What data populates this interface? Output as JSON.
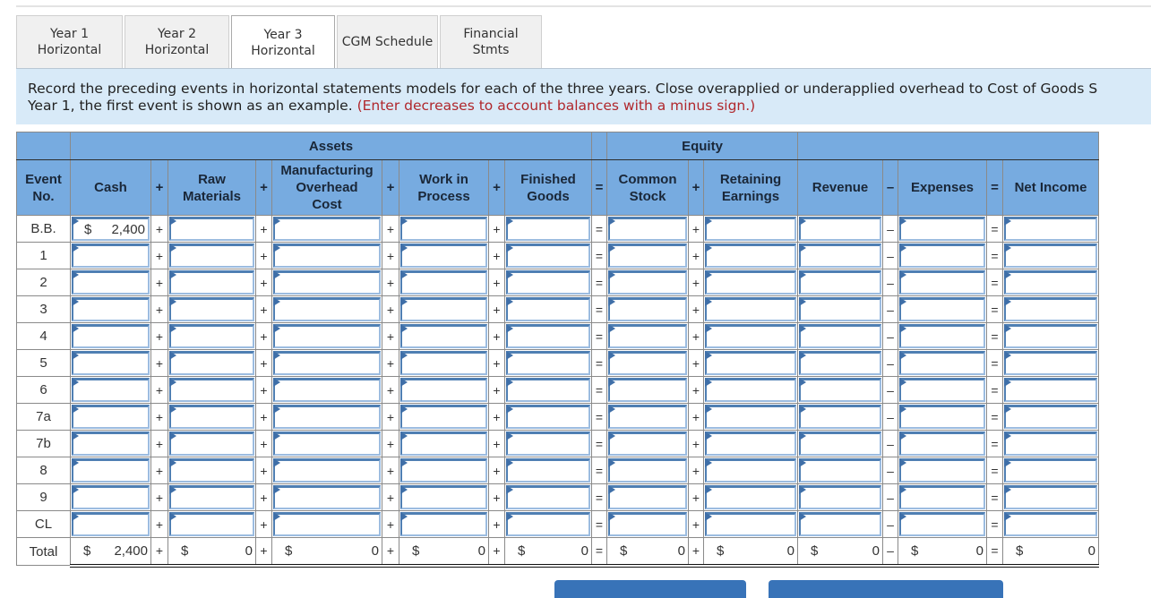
{
  "tabs": [
    {
      "label": "Year 1\nHorizontal",
      "line1": "Year 1",
      "line2": "Horizontal",
      "active": false
    },
    {
      "label": "Year 2\nHorizontal",
      "line1": "Year 2",
      "line2": "Horizontal",
      "active": false
    },
    {
      "label": "Year 3\nHorizontal",
      "line1": "Year 3",
      "line2": "Horizontal",
      "active": true
    },
    {
      "label": "CGM Schedule",
      "line1": "CGM Schedule",
      "line2": "",
      "active": false
    },
    {
      "label": "Financial\nStmts",
      "line1": "Financial",
      "line2": "Stmts",
      "active": false
    }
  ],
  "instructions": {
    "line1": "Record the preceding events in horizontal statements models for each of the three years. Close overapplied or underapplied overhead to Cost of Goods S",
    "line2": "Year 1, the first event is shown as an example. ",
    "hint": "(Enter decreases to account balances with a minus sign.)"
  },
  "table": {
    "group_headers": {
      "assets": "Assets",
      "equity": "Equity"
    },
    "column_headers": {
      "event": [
        "Event",
        "No."
      ],
      "cash": [
        "Cash"
      ],
      "raw_materials": [
        "Raw",
        "Materials"
      ],
      "moh": [
        "Manufacturing",
        "Overhead",
        "Cost"
      ],
      "wip": [
        "Work in",
        "Process"
      ],
      "fg": [
        "Finished",
        "Goods"
      ],
      "cs": [
        "Common",
        "Stock"
      ],
      "re": [
        "Retaining",
        "Earnings"
      ],
      "revenue": [
        "Revenue"
      ],
      "expenses": [
        "Expenses"
      ],
      "net_income": [
        "Net Income"
      ]
    },
    "operators": [
      "+",
      "+",
      "+",
      "+",
      "=",
      "+",
      "",
      "–",
      "="
    ],
    "header_operators": [
      "+",
      "+",
      "+",
      "+",
      "=",
      "+",
      "",
      "–",
      "="
    ],
    "rows": [
      {
        "event": "B.B.",
        "cash": "2,400",
        "cash_currency": "$"
      },
      {
        "event": "1"
      },
      {
        "event": "2"
      },
      {
        "event": "3"
      },
      {
        "event": "4"
      },
      {
        "event": "5"
      },
      {
        "event": "6"
      },
      {
        "event": "7a"
      },
      {
        "event": "7b"
      },
      {
        "event": "8"
      },
      {
        "event": "9"
      },
      {
        "event": "CL"
      }
    ],
    "total": {
      "label": "Total",
      "currency": "$",
      "cash": "2,400",
      "raw_materials": "0",
      "moh": "0",
      "wip": "0",
      "fg": "0",
      "cs": "0",
      "re": "0",
      "revenue": "0",
      "expenses": "0",
      "net_income": "0"
    }
  },
  "colors": {
    "header_bg": "#77abe0",
    "instruction_bg": "#d8eaf8",
    "hint": "#b0272c",
    "button": "#3873b8"
  }
}
